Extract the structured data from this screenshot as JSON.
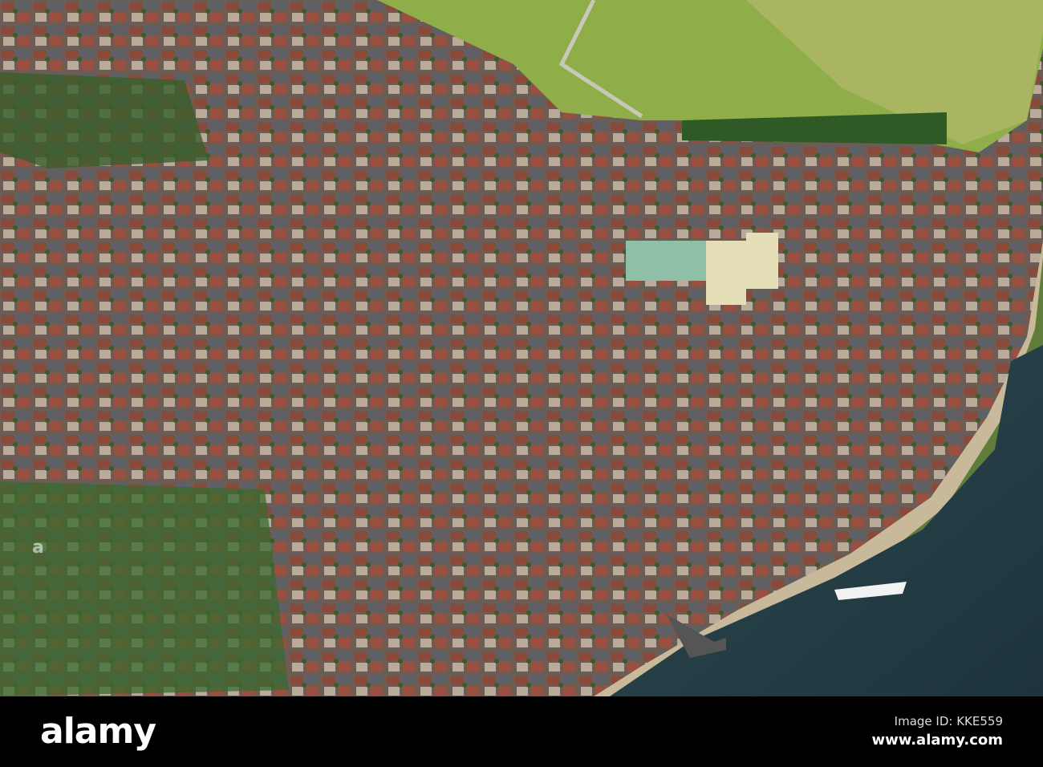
{
  "watermark": {
    "logo_text": "alamy",
    "image_id": "Image ID: KKE559",
    "site": "www.alamy.com"
  },
  "colors": {
    "field": "#8fae4a",
    "town_roof": "#7a5a4a",
    "river": "#23404a",
    "trees": "#2f5a26"
  }
}
